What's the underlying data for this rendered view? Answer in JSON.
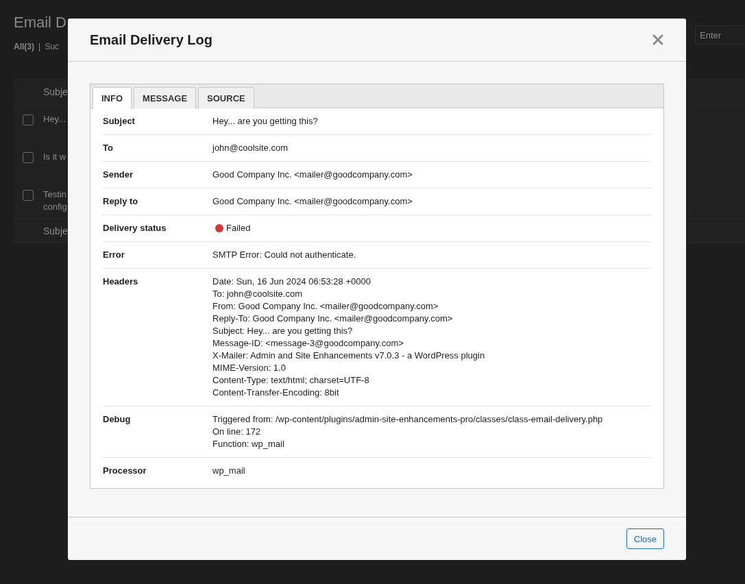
{
  "background_page": {
    "title": "Email D",
    "filters": [
      {
        "label": "All",
        "count": "(3)",
        "selected": true
      },
      {
        "label": "Suc",
        "selected": false
      }
    ],
    "separator": "|",
    "search": {
      "placeholder": "Enter"
    },
    "table": {
      "header": "Subje",
      "rows": [
        {
          "checked": false,
          "lines": [
            "Hey..."
          ]
        },
        {
          "checked": false,
          "lines": [
            "Is it w"
          ]
        },
        {
          "checked": false,
          "lines": [
            "Testin",
            "config"
          ]
        }
      ],
      "footer": "Subje"
    }
  },
  "modal": {
    "title": "Email Delivery Log",
    "tabs": [
      {
        "label": "INFO",
        "selected": true
      },
      {
        "label": "MESSAGE",
        "selected": false
      },
      {
        "label": "SOURCE",
        "selected": false
      }
    ],
    "rows": [
      {
        "kind": "text",
        "label": "Subject",
        "value": "Hey... are you getting this?"
      },
      {
        "kind": "text",
        "label": "To",
        "value": "john@coolsite.com"
      },
      {
        "kind": "text",
        "label": "Sender",
        "value": "Good Company Inc. <mailer@goodcompany.com>"
      },
      {
        "kind": "text",
        "label": "Reply to",
        "value": "Good Company Inc. <mailer@goodcompany.com>"
      },
      {
        "kind": "status",
        "label": "Delivery status",
        "value": "Failed",
        "color": "#d63638"
      },
      {
        "kind": "text",
        "label": "Error",
        "value": "SMTP Error: Could not authenticate."
      },
      {
        "kind": "lines",
        "label": "Headers",
        "lines": [
          "Date: Sun, 16 Jun 2024 06:53:28 +0000",
          "To: john@coolsite.com",
          "From: Good Company Inc. <mailer@goodcompany.com>",
          "Reply-To: Good Company Inc. <mailer@goodcompany.com>",
          "Subject: Hey... are you getting this?",
          "Message-ID: <message-3@goodcompany.com>",
          "X-Mailer: Admin and Site Enhancements v7.0.3 - a WordPress plugin",
          "MIME-Version: 1.0",
          "Content-Type: text/html; charset=UTF-8",
          "Content-Transfer-Encoding: 8bit"
        ]
      },
      {
        "kind": "lines",
        "label": "Debug",
        "lines": [
          "Triggered from: /wp-content/plugins/admin-site-enhancements-pro/classes/class-email-delivery.php",
          "On line: 172",
          "Function: wp_mail"
        ]
      },
      {
        "kind": "text",
        "label": "Processor",
        "value": "wp_mail"
      }
    ],
    "button": "Close"
  }
}
